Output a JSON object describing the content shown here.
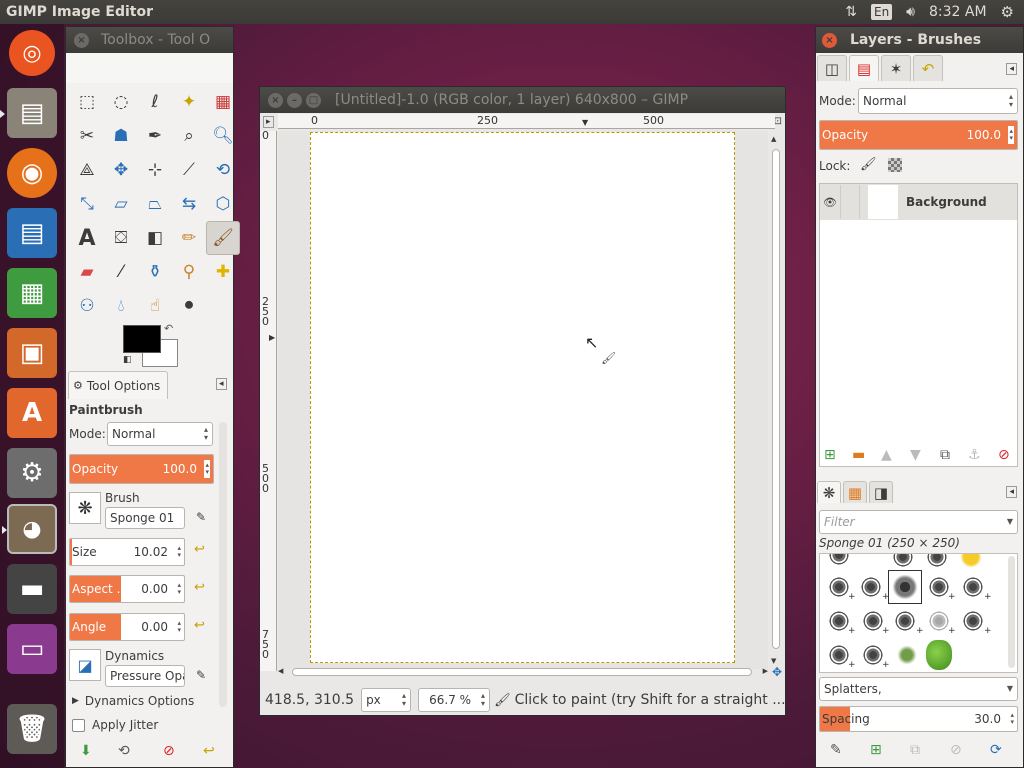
{
  "top_panel": {
    "app_title": "GIMP Image Editor",
    "keyboard": "En",
    "time": "8:32 AM"
  },
  "toolbox": {
    "title": "Toolbox - Tool O",
    "tool_options_tab": "Tool Options",
    "tool_name": "Paintbrush",
    "mode_label": "Mode:",
    "mode_value": "Normal",
    "opacity_label": "Opacity",
    "opacity_value": "100.0",
    "brush_label": "Brush",
    "brush_value": "Sponge 01",
    "size_label": "Size",
    "size_value": "10.02",
    "aspect_label": "Aspect ...",
    "aspect_value": "0.00",
    "angle_label": "Angle",
    "angle_value": "0.00",
    "dynamics_label": "Dynamics",
    "dynamics_value": "Pressure Opa",
    "dynamics_options": "Dynamics Options",
    "apply_jitter": "Apply Jitter",
    "colors": {
      "fg": "#000000",
      "bg": "#ffffff"
    }
  },
  "image_window": {
    "title": "[Untitled]-1.0 (RGB color, 1 layer) 640x800 – GIMP",
    "hruler_ticks": [
      "0",
      "250",
      "500"
    ],
    "vruler_ticks": [
      "0",
      "250",
      "500",
      "750"
    ],
    "coords": "418.5, 310.5",
    "unit": "px",
    "zoom": "66.7 %",
    "status_message": "Click to paint (try Shift for a straight ..."
  },
  "layers": {
    "title": "Layers - Brushes",
    "mode_label": "Mode:",
    "mode_value": "Normal",
    "opacity_label": "Opacity",
    "opacity_value": "100.0",
    "lock_label": "Lock:",
    "layer_name": "Background",
    "filter_placeholder": "Filter",
    "brush_name": "Sponge 01 (250 × 250)",
    "brush_tag": "Splatters,",
    "spacing_label": "Spacing",
    "spacing_value": "30.0"
  },
  "accent": "#f07746"
}
